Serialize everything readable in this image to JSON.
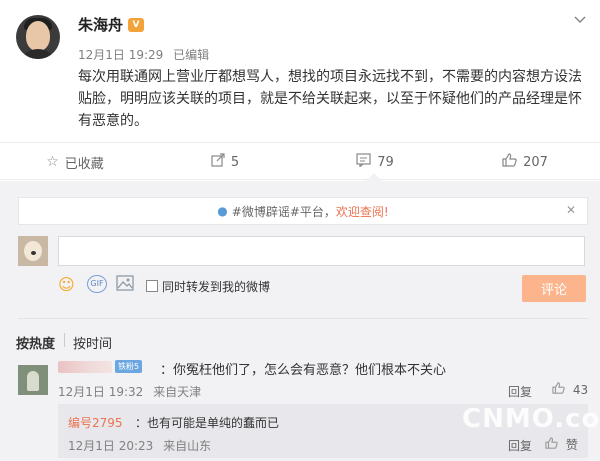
{
  "post": {
    "author": "朱海舟",
    "vip_badge": "V",
    "time": "12月1日 19:29",
    "edited": "已编辑",
    "menu_icon": "chevron-down-icon",
    "text": "每次用联通网上营业厅都想骂人，想找的项目永远找不到，不需要的内容想方设法贴脸，明明应该关联的项目，就是不给关联起来，以至于怀疑他们的产品经理是怀有恶意的。"
  },
  "actions": {
    "favorite": {
      "icon": "star-icon",
      "label": "已收藏"
    },
    "repost": {
      "icon": "share-icon",
      "count": "5"
    },
    "comment": {
      "icon": "comment-icon",
      "count": "79"
    },
    "like": {
      "icon": "thumbs-up-icon",
      "count": "207"
    }
  },
  "notice": {
    "prefix": "#微博辟谣#平台，",
    "highlight": "欢迎查阅!"
  },
  "composer": {
    "placeholder": "",
    "repost_checkbox_label": "同时转发到我的微博",
    "submit_label": "评论",
    "tools": [
      "emoji-icon",
      "gif-icon",
      "image-icon"
    ]
  },
  "sort_tabs": {
    "hot": "按热度",
    "time": "按时间"
  },
  "comments": [
    {
      "badge": "铁粉5",
      "text": "：你冤枉他们了，怎么会有恶意？他们根本不关心",
      "time": "12月1日 19:32",
      "source": "来自天津",
      "reply_label": "回复",
      "likes": "43",
      "replies": [
        {
          "user": "编号2795",
          "text": "：也有可能是单纯的蠢而已",
          "time": "12月1日 20:23",
          "source": "来自山东",
          "reply_label": "回复",
          "like_label": "赞"
        }
      ]
    }
  ],
  "watermark": "CNMO.com",
  "colors": {
    "accent": "#eb7350",
    "submit_bg": "#fbb48c",
    "panel_bg": "#f2f2f5"
  }
}
